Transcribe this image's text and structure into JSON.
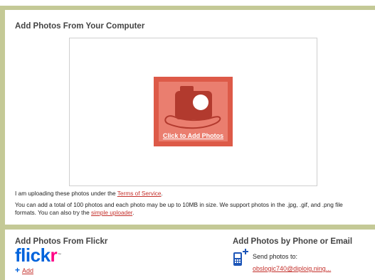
{
  "upload_section": {
    "title": "Add Photos From Your Computer",
    "add_button_label": "Click to Add Photos"
  },
  "terms": {
    "prefix": "I am uploading these photos under the ",
    "link": "Terms of Service",
    "suffix": "."
  },
  "limits": {
    "text": "You can add a total of 100 photos and each photo may be up to 10MB in size. We support photos in the .jpg, .gif, and .png file formats. You can also try the ",
    "link": "simple uploader",
    "suffix": "."
  },
  "flickr": {
    "title": "Add Photos From Flickr",
    "logo_part1": "flick",
    "logo_part2": "r",
    "logo_tm": "™",
    "add_label": "Add",
    "plus": "+"
  },
  "phone": {
    "title": "Add Photos by Phone or Email",
    "send_label": "Send photos to:",
    "email": "obslogic740@diploig.ning..."
  },
  "colors": {
    "frame": "#c4c996",
    "accent_red": "#c4302b",
    "tile_outer": "#dd5a48",
    "tile_inner": "#ea7e6f",
    "flickr_blue": "#0063dc",
    "flickr_pink": "#ff0084"
  },
  "icons": [
    "camera-icon",
    "phone-plus-icon",
    "plus-icon"
  ]
}
